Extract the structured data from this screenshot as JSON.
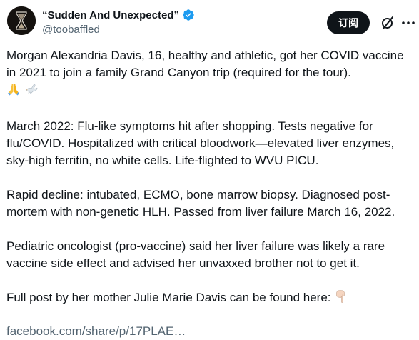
{
  "author": {
    "display_name": "“Sudden And Unexpected”",
    "handle": "@toobaffled",
    "verified": true,
    "verified_color": "#1d9bf0",
    "avatar_icon": "hourglass-avatar"
  },
  "actions": {
    "subscribe_label": "订阅",
    "grok_icon": "grok-slash-icon",
    "more_icon": "more-dots-icon"
  },
  "tweet": {
    "p1_text": "Morgan Alexandria Davis, 16, healthy and athletic, got her COVID vaccine in 2021 to join a family Grand Canyon trip (required for the tour).",
    "p1_emojis": [
      "folded-hands-emoji",
      "dove-emoji"
    ],
    "p2_text": "March 2022: Flu-like symptoms hit after shopping. Tests negative for flu/COVID. Hospitalized with critical bloodwork—elevated liver enzymes, sky-high ferritin, no white cells. Life-flighted to WVU PICU.",
    "p3_text": "Rapid decline: intubated, ECMO, bone marrow biopsy. Diagnosed post-mortem with non-genetic HLH. Passed from liver failure March 16, 2022.",
    "p4_text": "Pediatric oncologist (pro-vaccine) said her liver failure was likely a rare vaccine side effect and advised her unvaxxed brother not to get it.",
    "p5_text": "Full post by her mother Julie Marie Davis can be found here:",
    "p5_emoji": "pointing-down-emoji",
    "link_text": "facebook.com/share/p/17PLAE…"
  },
  "colors": {
    "text": "#0f1419",
    "muted": "#536471",
    "button_bg": "#0f1419"
  }
}
